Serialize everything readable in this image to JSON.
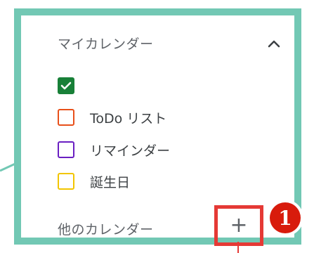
{
  "my_calendars": {
    "title": "マイカレンダー",
    "collapse_icon": "chevron-up-icon",
    "items": [
      {
        "label": "",
        "color": "#188038",
        "checked": true
      },
      {
        "label": "ToDo リスト",
        "color": "#e8501a",
        "checked": false
      },
      {
        "label": "リマインダー",
        "color": "#6a1fc2",
        "checked": false
      },
      {
        "label": "誕生日",
        "color": "#f2c500",
        "checked": false
      }
    ]
  },
  "other_calendars": {
    "title": "他のカレンダー",
    "add_symbol": "+"
  },
  "callout": {
    "number": "1",
    "highlight_color": "#e53935",
    "frame_color": "#72c8b4",
    "badge_color": "#d81b0c"
  }
}
